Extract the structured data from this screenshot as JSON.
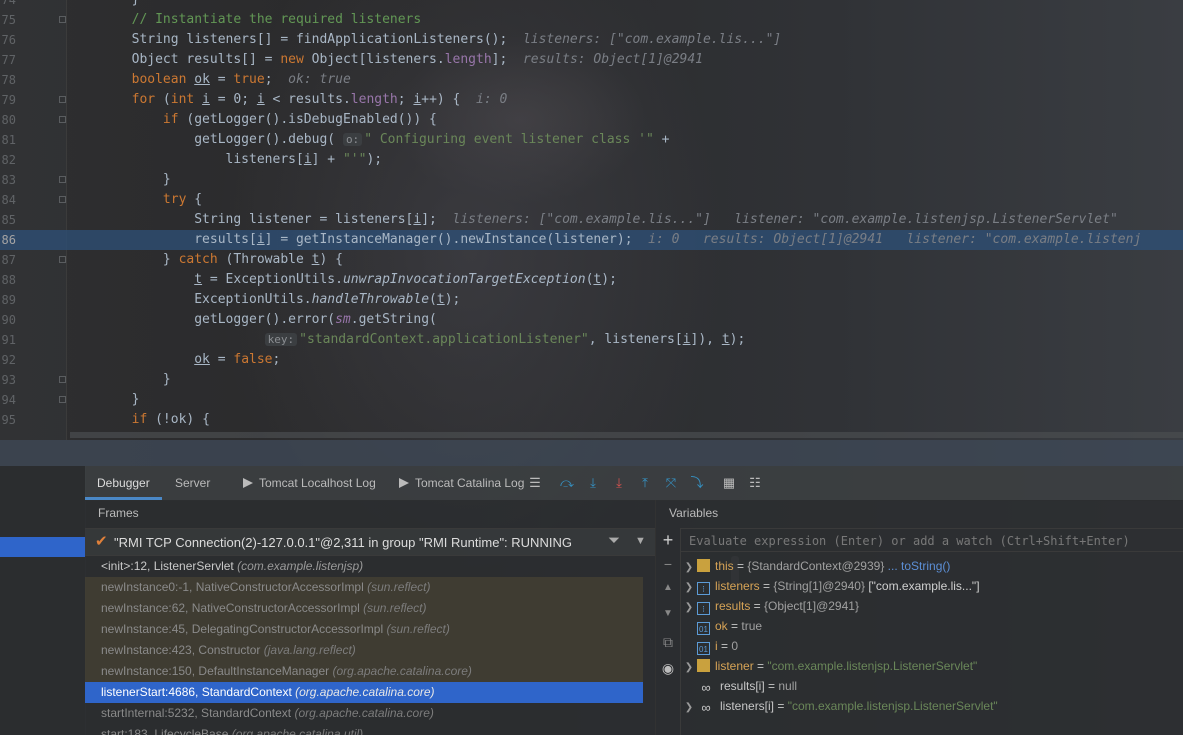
{
  "editor": {
    "lines": [
      {
        "n": "74",
        "parts": [
          {
            "t": "        }",
            "c": ""
          }
        ]
      },
      {
        "n": "75",
        "parts": [
          {
            "t": "        // Instantiate the required listeners",
            "c": "c"
          }
        ]
      },
      {
        "n": "76",
        "parts": [
          {
            "t": "        String listeners[] = findApplicationListeners();",
            "c": ""
          },
          {
            "t": "  listeners: [\"com.example.lis...\"]",
            "c": "hint"
          }
        ]
      },
      {
        "n": "77",
        "parts": [
          {
            "t": "        Object results[] = ",
            "c": ""
          },
          {
            "t": "new",
            "c": "k"
          },
          {
            "t": " Object[listeners.",
            "c": ""
          },
          {
            "t": "length",
            "c": "f"
          },
          {
            "t": "];",
            "c": ""
          },
          {
            "t": "  results: Object[1]@2941",
            "c": "hint"
          }
        ]
      },
      {
        "n": "78",
        "parts": [
          {
            "t": "        ",
            "c": ""
          },
          {
            "t": "boolean",
            "c": "k"
          },
          {
            "t": " ",
            "c": ""
          },
          {
            "t": "ok",
            "c": "ul"
          },
          {
            "t": " = ",
            "c": ""
          },
          {
            "t": "true",
            "c": "k"
          },
          {
            "t": ";",
            "c": ""
          },
          {
            "t": "  ok: true",
            "c": "hint"
          }
        ]
      },
      {
        "n": "79",
        "parts": [
          {
            "t": "        ",
            "c": ""
          },
          {
            "t": "for",
            "c": "k"
          },
          {
            "t": " (",
            "c": ""
          },
          {
            "t": "int",
            "c": "k"
          },
          {
            "t": " ",
            "c": ""
          },
          {
            "t": "i",
            "c": "ul"
          },
          {
            "t": " = 0; ",
            "c": ""
          },
          {
            "t": "i",
            "c": "ul"
          },
          {
            "t": " < results.",
            "c": ""
          },
          {
            "t": "length",
            "c": "f"
          },
          {
            "t": "; ",
            "c": ""
          },
          {
            "t": "i",
            "c": "ul"
          },
          {
            "t": "++) {",
            "c": ""
          },
          {
            "t": "  i: 0",
            "c": "hint"
          }
        ]
      },
      {
        "n": "80",
        "parts": [
          {
            "t": "            ",
            "c": ""
          },
          {
            "t": "if",
            "c": "k"
          },
          {
            "t": " (getLogger().isDebugEnabled()) {",
            "c": ""
          }
        ]
      },
      {
        "n": "81",
        "parts": [
          {
            "t": "                getLogger().debug( ",
            "c": ""
          },
          {
            "t": "o:",
            "c": "pill"
          },
          {
            "t": "\" Configuring event listener class '\"",
            "c": "s"
          },
          {
            "t": " +",
            "c": ""
          }
        ]
      },
      {
        "n": "82",
        "parts": [
          {
            "t": "                    listeners[",
            "c": ""
          },
          {
            "t": "i",
            "c": "ul"
          },
          {
            "t": "] + ",
            "c": ""
          },
          {
            "t": "\"'\"",
            "c": "s"
          },
          {
            "t": ");",
            "c": ""
          }
        ]
      },
      {
        "n": "83",
        "parts": [
          {
            "t": "            }",
            "c": ""
          }
        ]
      },
      {
        "n": "84",
        "parts": [
          {
            "t": "            ",
            "c": ""
          },
          {
            "t": "try",
            "c": "k"
          },
          {
            "t": " {",
            "c": ""
          }
        ]
      },
      {
        "n": "85",
        "parts": [
          {
            "t": "                String listener = listeners[",
            "c": ""
          },
          {
            "t": "i",
            "c": "ul"
          },
          {
            "t": "];",
            "c": ""
          },
          {
            "t": "  listeners: [\"com.example.lis...\"]   listener: \"com.example.listenjsp.ListenerServlet\"",
            "c": "hint"
          }
        ]
      },
      {
        "n": "86",
        "current": true,
        "parts": [
          {
            "t": "                results[",
            "c": ""
          },
          {
            "t": "i",
            "c": "ul"
          },
          {
            "t": "] = getInstanceManager().newInstance(listener);",
            "c": ""
          },
          {
            "t": "  i: 0   results: Object[1]@2941   listener: \"com.example.listenj",
            "c": "hint"
          }
        ]
      },
      {
        "n": "87",
        "parts": [
          {
            "t": "            } ",
            "c": ""
          },
          {
            "t": "catch",
            "c": "k"
          },
          {
            "t": " (Throwable ",
            "c": ""
          },
          {
            "t": "t",
            "c": "ul"
          },
          {
            "t": ") {",
            "c": ""
          }
        ]
      },
      {
        "n": "88",
        "parts": [
          {
            "t": "                ",
            "c": ""
          },
          {
            "t": "t",
            "c": "ul"
          },
          {
            "t": " = ExceptionUtils.",
            "c": ""
          },
          {
            "t": "unwrapInvocationTargetException",
            "c": "it"
          },
          {
            "t": "(",
            "c": ""
          },
          {
            "t": "t",
            "c": "ul"
          },
          {
            "t": ");",
            "c": ""
          }
        ]
      },
      {
        "n": "89",
        "parts": [
          {
            "t": "                ExceptionUtils.",
            "c": ""
          },
          {
            "t": "handleThrowable",
            "c": "it"
          },
          {
            "t": "(",
            "c": ""
          },
          {
            "t": "t",
            "c": "ul"
          },
          {
            "t": ");",
            "c": ""
          }
        ]
      },
      {
        "n": "90",
        "parts": [
          {
            "t": "                getLogger().error(",
            "c": ""
          },
          {
            "t": "sm",
            "c": "f it"
          },
          {
            "t": ".getString(",
            "c": ""
          }
        ]
      },
      {
        "n": "91",
        "parts": [
          {
            "t": "                         ",
            "c": ""
          },
          {
            "t": "key:",
            "c": "pill"
          },
          {
            "t": "\"standardContext.applicationListener\"",
            "c": "s"
          },
          {
            "t": ", listeners[",
            "c": ""
          },
          {
            "t": "i",
            "c": "ul"
          },
          {
            "t": "]), ",
            "c": ""
          },
          {
            "t": "t",
            "c": "ul"
          },
          {
            "t": ");",
            "c": ""
          }
        ]
      },
      {
        "n": "92",
        "parts": [
          {
            "t": "                ",
            "c": ""
          },
          {
            "t": "ok",
            "c": "ul"
          },
          {
            "t": " = ",
            "c": ""
          },
          {
            "t": "false",
            "c": "k"
          },
          {
            "t": ";",
            "c": ""
          }
        ]
      },
      {
        "n": "93",
        "parts": [
          {
            "t": "            }",
            "c": ""
          }
        ]
      },
      {
        "n": "94",
        "parts": [
          {
            "t": "        }",
            "c": ""
          }
        ]
      },
      {
        "n": "95",
        "parts": [
          {
            "t": "        ",
            "c": ""
          },
          {
            "t": "if",
            "c": "k"
          },
          {
            "t": " (!ok) {",
            "c": ""
          }
        ]
      }
    ]
  },
  "debugger": {
    "tabs": [
      {
        "label": "Debugger",
        "active": true,
        "icon": false
      },
      {
        "label": "Server",
        "active": false,
        "icon": false
      },
      {
        "label": "Tomcat Localhost Log",
        "active": false,
        "icon": true
      },
      {
        "label": "Tomcat Catalina Log",
        "active": false,
        "icon": true
      }
    ],
    "toolbar": [
      {
        "name": "show-execution-point-icon",
        "glyph": "☰"
      },
      {
        "name": "step-over-icon",
        "glyph": "⤼"
      },
      {
        "name": "step-into-icon",
        "glyph": "⤓"
      },
      {
        "name": "force-step-into-icon",
        "glyph": "⤓"
      },
      {
        "name": "step-out-icon",
        "glyph": "⤒"
      },
      {
        "name": "drop-frame-icon",
        "glyph": "⤧"
      },
      {
        "name": "run-to-cursor-icon",
        "glyph": "⤵"
      },
      {
        "name": "evaluate-expression-icon",
        "glyph": "▦"
      },
      {
        "name": "trace-icon",
        "glyph": "☷"
      }
    ],
    "frames_title": "Frames",
    "thread": "\"RMI TCP Connection(2)-127.0.0.1\"@2,311 in group \"RMI Runtime\": RUNNING",
    "frames": [
      {
        "method": "<init>:12, ListenerServlet",
        "pkg": "(com.example.listenjsp)",
        "kind": "first"
      },
      {
        "method": "newInstance0:-1, NativeConstructorAccessorImpl",
        "pkg": "(sun.reflect)",
        "kind": "lib"
      },
      {
        "method": "newInstance:62, NativeConstructorAccessorImpl",
        "pkg": "(sun.reflect)",
        "kind": "lib"
      },
      {
        "method": "newInstance:45, DelegatingConstructorAccessorImpl",
        "pkg": "(sun.reflect)",
        "kind": "lib"
      },
      {
        "method": "newInstance:423, Constructor",
        "pkg": "(java.lang.reflect)",
        "kind": "lib"
      },
      {
        "method": "newInstance:150, DefaultInstanceManager",
        "pkg": "(org.apache.catalina.core)",
        "kind": "lib"
      },
      {
        "method": "listenerStart:4686, StandardContext",
        "pkg": "(org.apache.catalina.core)",
        "kind": "selected"
      },
      {
        "method": "startInternal:5232, StandardContext",
        "pkg": "(org.apache.catalina.core)",
        "kind": "normal"
      },
      {
        "method": "start:183, LifecycleBase",
        "pkg": "(org.apache.catalina.util)",
        "kind": "normal"
      }
    ],
    "variables_title": "Variables",
    "eval_placeholder": "Evaluate expression (Enter) or add a watch (Ctrl+Shift+Enter)",
    "variables": [
      {
        "name": "this",
        "value": "{StandardContext@2939}",
        "extra": "... toString()",
        "icon": "obj",
        "expand": true,
        "str": false
      },
      {
        "name": "listeners",
        "value": "{String[1]@2940}",
        "extra": "[\"com.example.lis...\"]",
        "icon": "arr",
        "expand": true,
        "str": false
      },
      {
        "name": "results",
        "value": "{Object[1]@2941}",
        "extra": "",
        "icon": "arr",
        "expand": true,
        "str": false
      },
      {
        "name": "ok",
        "value": "true",
        "extra": "",
        "icon": "prim",
        "expand": false,
        "str": false
      },
      {
        "name": "i",
        "value": "0",
        "extra": "",
        "icon": "prim",
        "expand": false,
        "str": false
      },
      {
        "name": "listener",
        "value": "\"com.example.listenjsp.ListenerServlet\"",
        "extra": "",
        "icon": "obj",
        "expand": true,
        "str": true
      },
      {
        "name": "results[i]",
        "value": "null",
        "extra": "",
        "icon": "watch",
        "expand": false,
        "str": false
      },
      {
        "name": "listeners[i]",
        "value": "\"com.example.listenjsp.ListenerServlet\"",
        "extra": "",
        "icon": "watch",
        "expand": true,
        "str": true
      }
    ]
  }
}
